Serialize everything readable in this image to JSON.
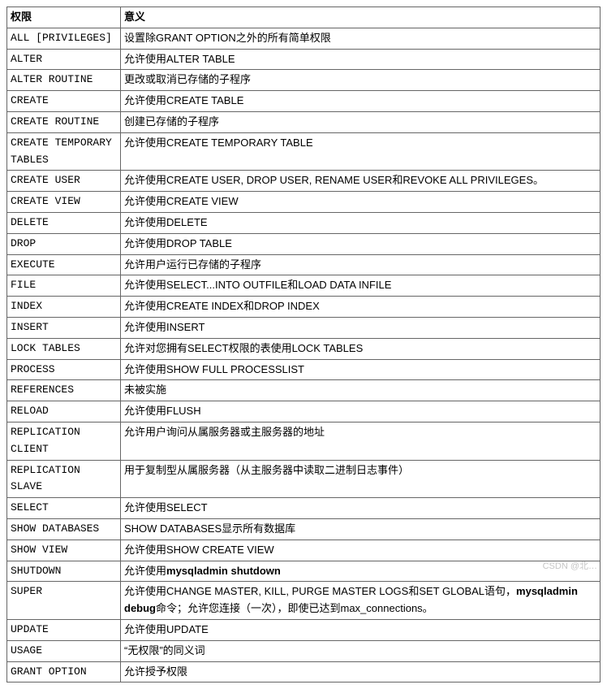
{
  "headers": {
    "privilege": "权限",
    "meaning": "意义"
  },
  "rows": [
    {
      "priv": "ALL [PRIVILEGES]",
      "desc": "设置除GRANT OPTION之外的所有简单权限"
    },
    {
      "priv": "ALTER",
      "desc": "允许使用ALTER TABLE"
    },
    {
      "priv": "ALTER ROUTINE",
      "desc": "更改或取消已存储的子程序"
    },
    {
      "priv": "CREATE",
      "desc": "允许使用CREATE TABLE"
    },
    {
      "priv": "CREATE ROUTINE",
      "desc": "创建已存储的子程序"
    },
    {
      "priv": "CREATE TEMPORARY TABLES",
      "desc": "允许使用CREATE TEMPORARY TABLE"
    },
    {
      "priv": "CREATE USER",
      "desc": "允许使用CREATE USER, DROP USER, RENAME USER和REVOKE ALL PRIVILEGES。"
    },
    {
      "priv": "CREATE VIEW",
      "desc": "允许使用CREATE VIEW"
    },
    {
      "priv": "DELETE",
      "desc": "允许使用DELETE"
    },
    {
      "priv": "DROP",
      "desc": "允许使用DROP TABLE"
    },
    {
      "priv": "EXECUTE",
      "desc": "允许用户运行已存储的子程序"
    },
    {
      "priv": "FILE",
      "desc": "允许使用SELECT...INTO OUTFILE和LOAD DATA INFILE"
    },
    {
      "priv": "INDEX",
      "desc": "允许使用CREATE INDEX和DROP INDEX"
    },
    {
      "priv": "INSERT",
      "desc": "允许使用INSERT"
    },
    {
      "priv": "LOCK TABLES",
      "desc": "允许对您拥有SELECT权限的表使用LOCK TABLES"
    },
    {
      "priv": "PROCESS",
      "desc": "允许使用SHOW FULL PROCESSLIST"
    },
    {
      "priv": "REFERENCES",
      "desc": "未被实施"
    },
    {
      "priv": "RELOAD",
      "desc": "允许使用FLUSH"
    },
    {
      "priv": "REPLICATION CLIENT",
      "desc": "允许用户询问从属服务器或主服务器的地址"
    },
    {
      "priv": "REPLICATION SLAVE",
      "desc": "用于复制型从属服务器（从主服务器中读取二进制日志事件）"
    },
    {
      "priv": "SELECT",
      "desc": "允许使用SELECT"
    },
    {
      "priv": "SHOW DATABASES",
      "desc": "SHOW DATABASES显示所有数据库"
    },
    {
      "priv": "SHOW VIEW",
      "desc": "允许使用SHOW CREATE VIEW"
    },
    {
      "priv": "SHUTDOWN",
      "desc": "允许使用mysqladmin shutdown",
      "style": "bold"
    },
    {
      "priv": "SUPER",
      "desc": "允许使用CHANGE MASTER, KILL, PURGE MASTER LOGS和SET GLOBAL语句，mysqladmin debug命令；允许您连接（一次），即使已达到max_connections。",
      "style": "super"
    },
    {
      "priv": "UPDATE",
      "desc": "允许使用UPDATE"
    },
    {
      "priv": "USAGE",
      "desc": "“无权限”的同义词"
    },
    {
      "priv": "GRANT OPTION",
      "desc": "允许授予权限"
    }
  ],
  "watermark": "CSDN @北…"
}
